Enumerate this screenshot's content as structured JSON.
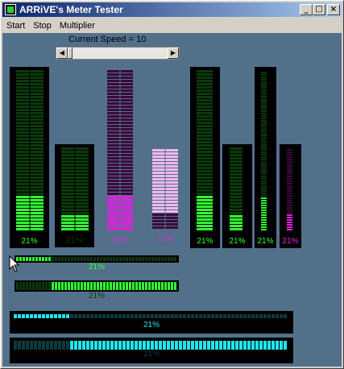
{
  "window": {
    "title": "ARRiVE's Meter Tester"
  },
  "titlebar_buttons": {
    "minimize": "_",
    "maximize": "□",
    "close": "×"
  },
  "menu": [
    "Start",
    "Stop",
    "Multiplier"
  ],
  "speed": {
    "label": "Current Speed = 10",
    "value": 10
  },
  "meters": {
    "percent_text": "21%",
    "level": 0.21,
    "colors": {
      "green_on": "#33ff33",
      "green_off": "#0b3a0b",
      "magenta_on": "#dd22dd",
      "magenta_off": "#3a0a3a",
      "cyan_on": "#22e5ee",
      "cyan_off": "#0b3a40",
      "pink_on": "#f0b8f0"
    }
  }
}
